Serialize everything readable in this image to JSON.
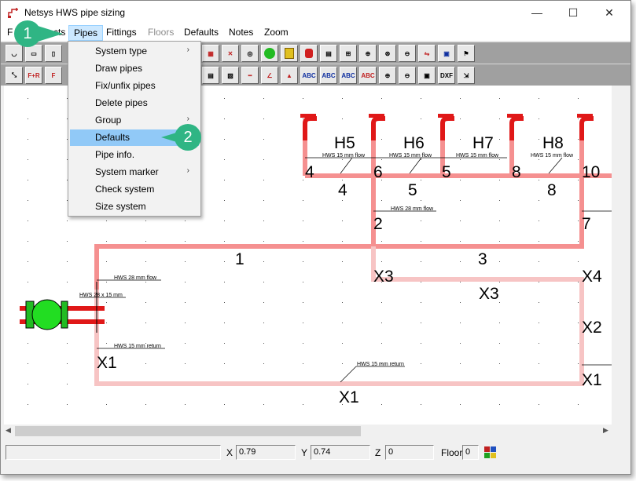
{
  "window": {
    "title": "Netsys HWS pipe sizing",
    "minimize_glyph": "—",
    "maximize_glyph": "☐",
    "close_glyph": "✕"
  },
  "menubar": {
    "items": [
      "File",
      "Objects",
      "Pipes",
      "Fittings",
      "Floors",
      "Defaults",
      "Notes",
      "Zoom"
    ],
    "visible_fragment_1": "F",
    "visible_fragment_2": "cts"
  },
  "pipes_menu": {
    "items": [
      {
        "label": "System type",
        "submenu": true
      },
      {
        "label": "Draw pipes",
        "submenu": false
      },
      {
        "label": "Fix/unfix pipes",
        "submenu": false
      },
      {
        "label": "Delete pipes",
        "submenu": false
      },
      {
        "label": "Group",
        "submenu": true
      },
      {
        "label": "Defaults",
        "submenu": false
      },
      {
        "label": "Pipe info.",
        "submenu": false
      },
      {
        "label": "System marker",
        "submenu": true
      },
      {
        "label": "Check system",
        "submenu": false
      },
      {
        "label": "Size system",
        "submenu": false
      }
    ],
    "arrow_glyph": "›",
    "highlighted": "Defaults"
  },
  "callouts": [
    {
      "number": "1"
    },
    {
      "number": "2"
    }
  ],
  "toolbar": {
    "row2_labels": [
      "F+R",
      "F",
      "ABC",
      "ABC",
      "ABC",
      "ABC",
      "DXF"
    ],
    "color": {
      "red": "#cc2020",
      "green": "#22aa22",
      "pipe": "#f08a8a",
      "pipe_light": "#f5c0c0"
    }
  },
  "drawing": {
    "heaters": [
      "H5",
      "H6",
      "H7",
      "H8"
    ],
    "node_numbers": [
      "4",
      "6",
      "5",
      "8",
      "10",
      "2",
      "7",
      "1",
      "3"
    ],
    "segment_labels": [
      "4",
      "5",
      "8",
      "X3",
      "X4",
      "X3",
      "X2",
      "X1",
      "X1",
      "X1"
    ],
    "pipe_notes": {
      "hws15flow": "HWS 15 mm flow",
      "hws28flow": "HWS 28 mm flow",
      "hws28x15": "HWS 28 x 15 mm",
      "hws15return": "HWS 15 mm return"
    }
  },
  "status": {
    "x_label": "X",
    "x_value": "0.79",
    "y_label": "Y",
    "y_value": "0.74",
    "z_label": "Z",
    "z_value": "0",
    "floor_label": "Floor",
    "floor_value": "0"
  },
  "scroll": {
    "left": "◀",
    "right": "▶"
  }
}
